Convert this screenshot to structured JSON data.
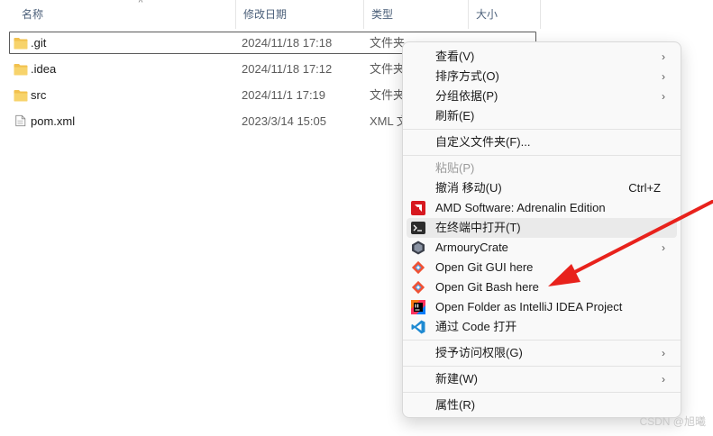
{
  "columns": {
    "name": "名称",
    "modified": "修改日期",
    "type": "类型",
    "size": "大小"
  },
  "files": [
    {
      "name": ".git",
      "date": "2024/11/18 17:18",
      "type": "文件夹",
      "icon": "folder-icon"
    },
    {
      "name": ".idea",
      "date": "2024/11/18 17:12",
      "type": "文件夹",
      "icon": "folder-icon"
    },
    {
      "name": "src",
      "date": "2024/11/1 17:19",
      "type": "文件夹",
      "icon": "folder-icon"
    },
    {
      "name": "pom.xml",
      "date": "2023/3/14 15:05",
      "type": "XML 文",
      "icon": "file-icon"
    }
  ],
  "menu": {
    "view": "查看(V)",
    "sort": "排序方式(O)",
    "group": "分组依据(P)",
    "refresh": "刷新(E)",
    "customize": "自定义文件夹(F)...",
    "paste": "粘贴(P)",
    "undo": "撤消 移动(U)",
    "undo_shortcut": "Ctrl+Z",
    "amd": "AMD Software: Adrenalin Edition",
    "terminal": "在终端中打开(T)",
    "armoury": "ArmouryCrate",
    "git_gui": "Open Git GUI here",
    "git_bash": "Open Git Bash here",
    "intellij": "Open Folder as IntelliJ IDEA Project",
    "vscode": "通过 Code 打开",
    "access": "授予访问权限(G)",
    "new": "新建(W)",
    "properties": "属性(R)"
  },
  "colors": {
    "arrow": "#e8221c",
    "amd": "#d71920",
    "vscode": "#1f8ad2",
    "folder": "#f2c14e"
  },
  "watermark": "CSDN @旭曦"
}
